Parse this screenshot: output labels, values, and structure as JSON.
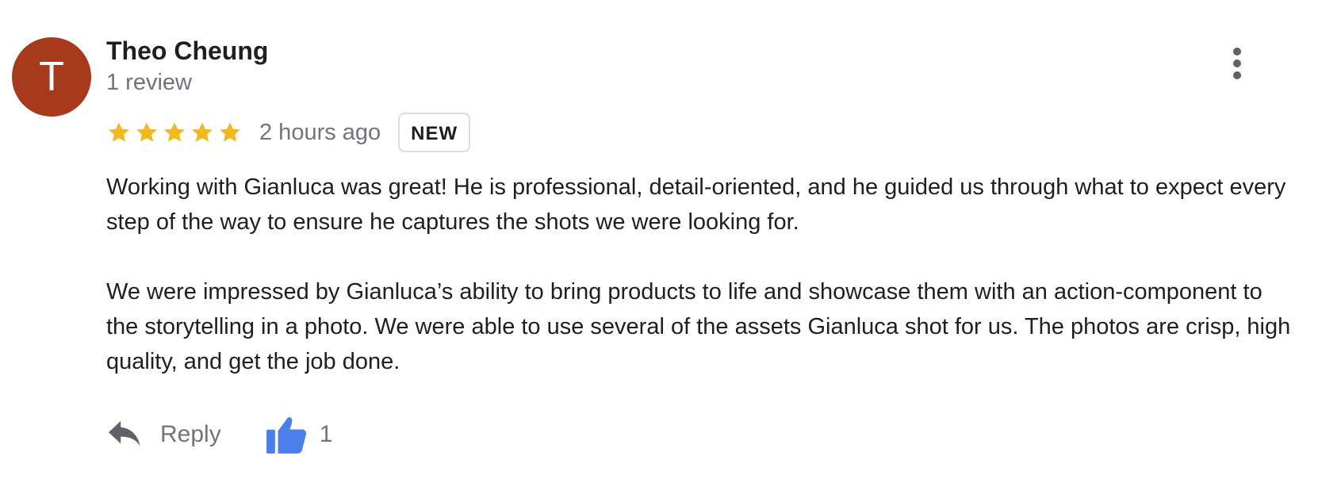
{
  "review": {
    "avatar_initial": "T",
    "author_name": "Theo Cheung",
    "review_count": "1 review",
    "rating": 5,
    "timestamp": "2 hours ago",
    "badge": "NEW",
    "paragraphs": [
      "Working with Gianluca was great! He is professional, detail-oriented, and he guided us through what to expect every step of the way to ensure he captures the shots we were looking for.",
      "We were impressed by Gianluca’s ability to bring products to life and showcase them with an action-component to the storytelling in a photo. We were able to use several of the assets Gianluca shot for us. The photos are crisp, high quality, and get the job done."
    ]
  },
  "actions": {
    "reply_label": "Reply",
    "like_count": "1"
  },
  "icons": {
    "star": "star-icon",
    "more": "more-vert-icon",
    "reply": "reply-icon",
    "like": "thumb-up-icon"
  },
  "colors": {
    "avatar": "#a63a1a",
    "star": "#f2b91e",
    "thumb": "#4a7ee8",
    "secondary_text": "#70757a"
  }
}
